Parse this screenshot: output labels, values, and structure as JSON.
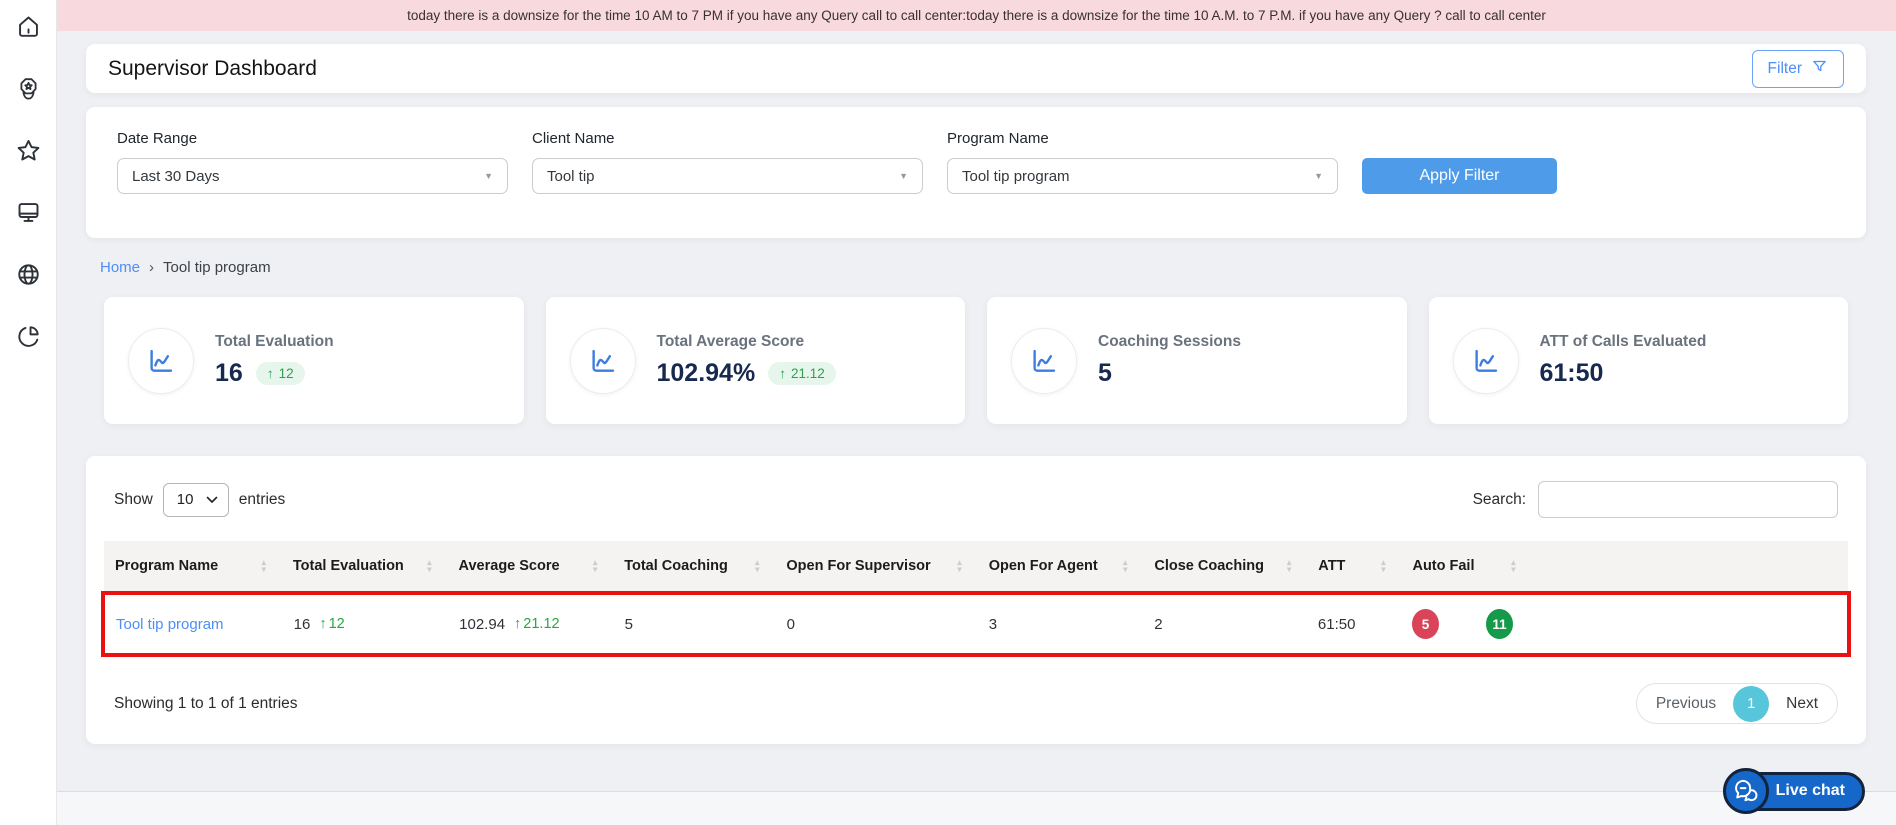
{
  "banner": {
    "text": "today there is a downsize for the time 10 AM to 7 PM if you have any Query call to call center:today there is a downsize for the time 10 A.M. to 7 P.M. if you have any Query ? call to call center"
  },
  "sidebar": {
    "items": [
      {
        "icon": "home-icon"
      },
      {
        "icon": "user-badge-icon"
      },
      {
        "icon": "star-icon"
      },
      {
        "icon": "monitor-icon"
      },
      {
        "icon": "globe-icon"
      },
      {
        "icon": "pie-chart-icon"
      }
    ]
  },
  "header": {
    "title": "Supervisor Dashboard",
    "filter_button": "Filter"
  },
  "filters": {
    "fields": [
      {
        "label": "Date Range",
        "value": "Last 30 Days"
      },
      {
        "label": "Client Name",
        "value": "Tool tip"
      },
      {
        "label": "Program Name",
        "value": "Tool tip program"
      }
    ],
    "apply_button": "Apply Filter"
  },
  "breadcrumb": {
    "home": "Home",
    "separator": "›",
    "current": "Tool tip program"
  },
  "stat_cards": [
    {
      "label": "Total Evaluation",
      "value": "16",
      "delta": "12"
    },
    {
      "label": "Total Average Score",
      "value": "102.94%",
      "delta": "21.12"
    },
    {
      "label": "Coaching Sessions",
      "value": "5"
    },
    {
      "label": "ATT of Calls Evaluated",
      "value": "61:50"
    }
  ],
  "table": {
    "show_label": "Show",
    "page_size": "10",
    "entries_label": "entries",
    "search_label": "Search:",
    "columns": [
      "Program Name",
      "Total Evaluation",
      "Average Score",
      "Total Coaching",
      "Open For Supervisor",
      "Open For Agent",
      "Close Coaching",
      "ATT",
      "Auto Fail"
    ],
    "row": {
      "program_name": "Tool tip program",
      "total_evaluation": "16",
      "total_evaluation_delta": "12",
      "average_score": "102.94",
      "average_score_delta": "21.12",
      "total_coaching": "5",
      "open_for_supervisor": "0",
      "open_for_agent": "3",
      "close_coaching": "2",
      "att": "61:50",
      "auto_fail_red": "5",
      "auto_fail_green": "11"
    },
    "footer": {
      "info": "Showing 1 to 1 of 1 entries",
      "previous": "Previous",
      "page": "1",
      "next": "Next"
    }
  },
  "live_chat": {
    "label": "Live chat"
  },
  "icons": {
    "arrow_up": "↑",
    "sort_up": "▴",
    "sort_down": "▾",
    "caret_down": "▼"
  },
  "colors": {
    "accent_blue": "#4e9ce9",
    "link_blue": "#4d8ef7",
    "success_green": "#28a745",
    "danger_red": "#d94459",
    "badge_green": "#159a4a",
    "banner_pink": "#f8d9de",
    "pagination_active": "#57c5da",
    "annotation_red": "#ec1111",
    "live_chat_blue": "#1568c9",
    "stat_value_navy": "#17294e"
  }
}
